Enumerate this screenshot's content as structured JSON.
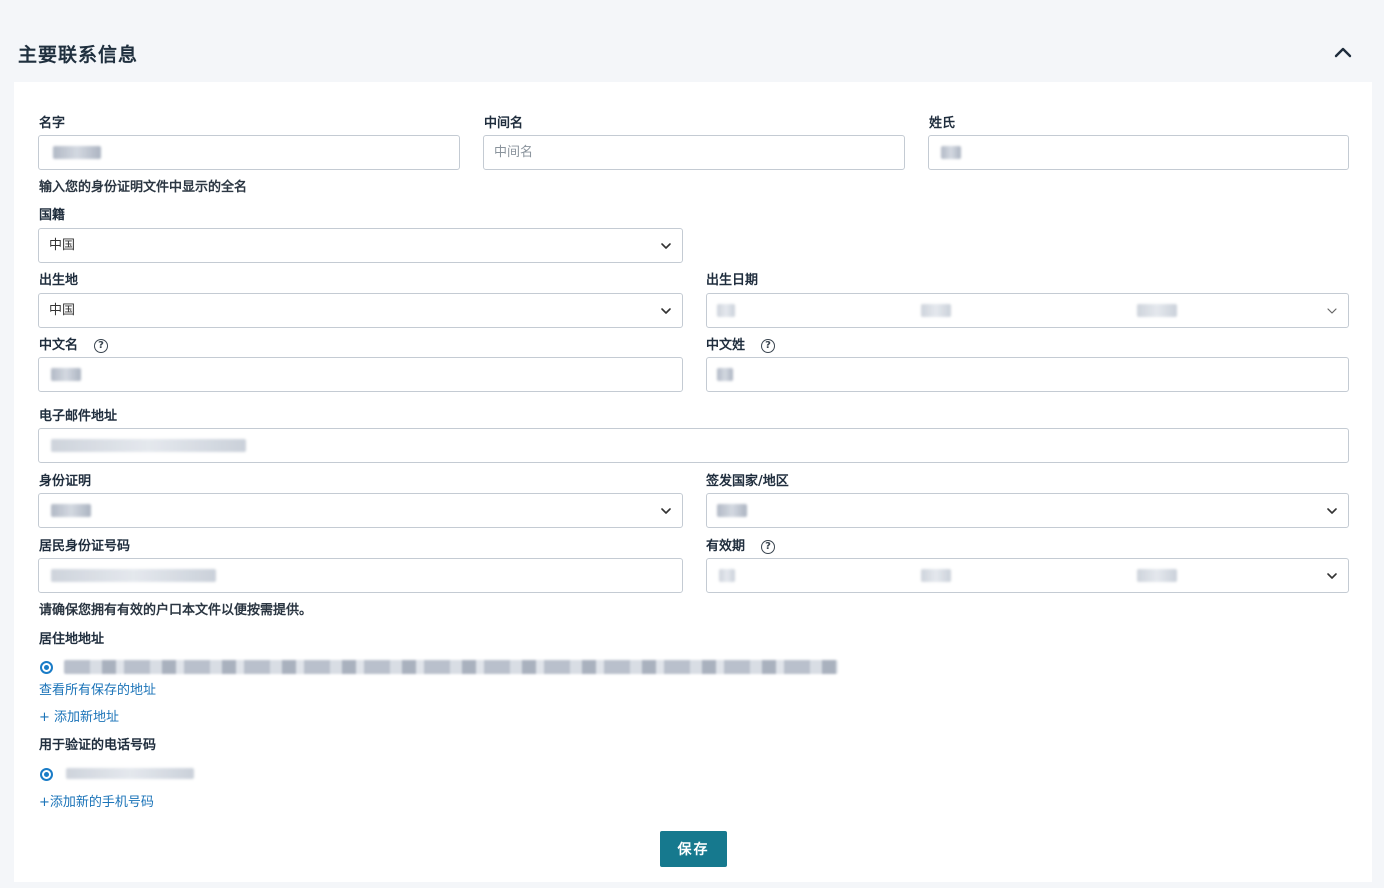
{
  "section": {
    "title": "主要联系信息",
    "collapse_icon": "chevron-up-icon"
  },
  "name": {
    "first_label": "名字",
    "middle_label": "中间名",
    "middle_placeholder": "中间名",
    "last_label": "姓氏",
    "hint": "输入您的身份证明文件中显示的全名"
  },
  "nationality": {
    "label": "国籍",
    "value": "中国"
  },
  "birthplace": {
    "label": "出生地",
    "value": "中国"
  },
  "birthdate": {
    "label": "出生日期"
  },
  "chinese_given_name": {
    "label": "中文名"
  },
  "chinese_surname": {
    "label": "中文姓"
  },
  "email": {
    "label": "电子邮件地址"
  },
  "id_document": {
    "label": "身份证明"
  },
  "issuing_country": {
    "label": "签发国家/地区"
  },
  "id_number": {
    "label": "居民身份证号码"
  },
  "expiry": {
    "label": "有效期"
  },
  "hukou_hint": "请确保您拥有有效的户口本文件以便按需提供。",
  "residence": {
    "label": "居住地地址",
    "view_all_link": "查看所有保存的地址",
    "add_link": "+ 添加新地址"
  },
  "phone": {
    "label": "用于验证的电话号码",
    "add_link": "+添加新的手机号码"
  },
  "save_label": "保存",
  "help_glyph": "?",
  "colors": {
    "accent": "#16798e",
    "link": "#1a73b8",
    "border": "#c4cbd3"
  }
}
